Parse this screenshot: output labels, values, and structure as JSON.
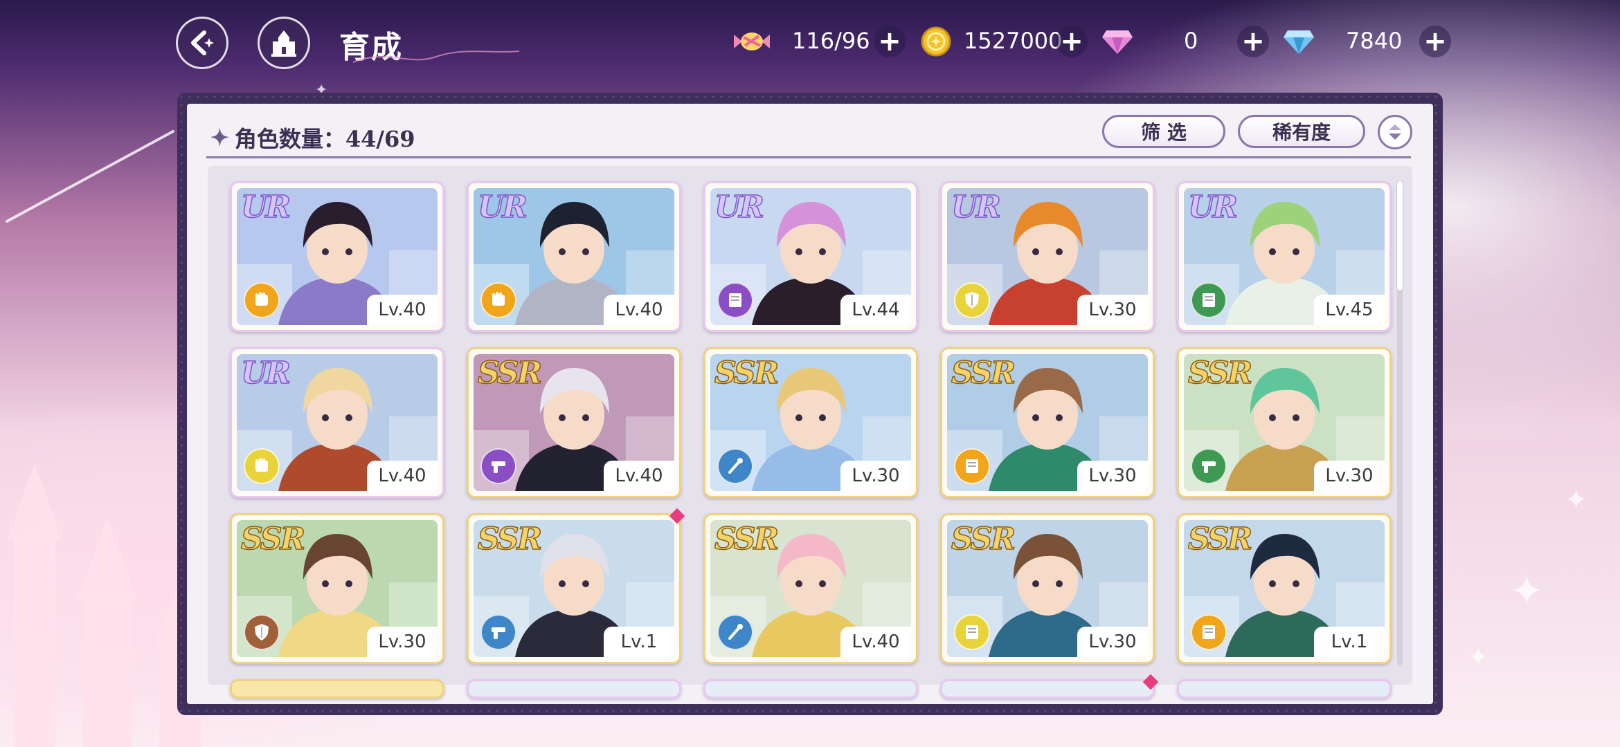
{
  "header": {
    "title": "育成",
    "resources": [
      {
        "name": "stamina",
        "icon": "candy-icon",
        "value": "116/96"
      },
      {
        "name": "gold",
        "icon": "coin-icon",
        "value": "1527000"
      },
      {
        "name": "paid_gem",
        "icon": "pink-diamond-icon",
        "value": "0"
      },
      {
        "name": "free_gem",
        "icon": "blue-diamond-icon",
        "value": "7840"
      }
    ],
    "plus_label": "+"
  },
  "panel": {
    "count_label": "角色数量：44/69",
    "filter_label": "筛 选",
    "sort_label": "稀有度"
  },
  "cards": [
    {
      "rarity": "UR",
      "level": "Lv.40",
      "class_color": "#f0a51a",
      "class_icon": "fist-icon",
      "palette": [
        "#b7c8ee",
        "#2a1e2e",
        "#8a7ac8"
      ]
    },
    {
      "rarity": "UR",
      "level": "Lv.40",
      "class_color": "#f0a51a",
      "class_icon": "fist-icon",
      "palette": [
        "#9ec6e6",
        "#1d2230",
        "#b0b4c4"
      ]
    },
    {
      "rarity": "UR",
      "level": "Lv.44",
      "class_color": "#8a4fc4",
      "class_icon": "book-icon",
      "palette": [
        "#c8d8f0",
        "#d592d8",
        "#2a1e2a"
      ]
    },
    {
      "rarity": "UR",
      "level": "Lv.30",
      "class_color": "#e8d43a",
      "class_icon": "shield-icon",
      "palette": [
        "#b8c8e0",
        "#e88a2c",
        "#c8402e"
      ]
    },
    {
      "rarity": "UR",
      "level": "Lv.45",
      "class_color": "#3e9a52",
      "class_icon": "book-icon",
      "palette": [
        "#b8d0e8",
        "#9ed27a",
        "#e8f0e8"
      ]
    },
    {
      "rarity": "UR",
      "level": "Lv.40",
      "class_color": "#e8d43a",
      "class_icon": "fist-icon",
      "palette": [
        "#b8cce8",
        "#f0d7a0",
        "#b04a2c"
      ]
    },
    {
      "rarity": "SSR",
      "level": "Lv.40",
      "class_color": "#8a4fc4",
      "class_icon": "gun-icon",
      "palette": [
        "#c098b8",
        "#e8e4ee",
        "#222230"
      ]
    },
    {
      "rarity": "SSR",
      "level": "Lv.30",
      "class_color": "#3e86c8",
      "class_icon": "wand-icon",
      "palette": [
        "#b8d4ee",
        "#e8c878",
        "#98bce8"
      ]
    },
    {
      "rarity": "SSR",
      "level": "Lv.30",
      "class_color": "#f0a51a",
      "class_icon": "book-icon",
      "palette": [
        "#b0cce6",
        "#9a6a48",
        "#2e8a6a"
      ]
    },
    {
      "rarity": "SSR",
      "level": "Lv.30",
      "class_color": "#3e9a52",
      "class_icon": "gun-icon",
      "palette": [
        "#cce0c4",
        "#5ec69a",
        "#c8a050"
      ]
    },
    {
      "rarity": "SSR",
      "level": "Lv.30",
      "class_color": "#a0603a",
      "class_icon": "shield-icon",
      "palette": [
        "#bcd8b0",
        "#6a4432",
        "#f0d884"
      ]
    },
    {
      "rarity": "SSR",
      "level": "Lv.1",
      "class_color": "#3e86c8",
      "class_icon": "gun-icon",
      "palette": [
        "#c8dcec",
        "#e0e0ea",
        "#2a2a3a"
      ]
    },
    {
      "rarity": "SSR",
      "level": "Lv.40",
      "class_color": "#3e86c8",
      "class_icon": "wand-icon",
      "palette": [
        "#d8e4d0",
        "#f4b8c8",
        "#e8c860"
      ]
    },
    {
      "rarity": "SSR",
      "level": "Lv.30",
      "class_color": "#e8d43a",
      "class_icon": "book-icon",
      "palette": [
        "#c0d4e8",
        "#7a5238",
        "#2e6a8a"
      ]
    },
    {
      "rarity": "SSR",
      "level": "Lv.1",
      "class_color": "#f0a51a",
      "class_icon": "book-icon",
      "palette": [
        "#c4d8ec",
        "#1e2a40",
        "#2e6a5a"
      ]
    }
  ]
}
